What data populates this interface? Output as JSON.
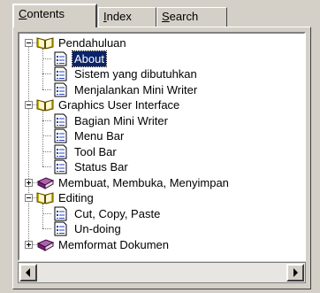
{
  "tabs": [
    {
      "label_ul": "C",
      "label_rest": "ontents",
      "active": true
    },
    {
      "label_ul": "I",
      "label_rest": "ndex",
      "active": false
    },
    {
      "label_ul": "S",
      "label_rest": "earch",
      "active": false
    }
  ],
  "tree": [
    {
      "level": 0,
      "type": "book-open",
      "expander": "minus",
      "label": "Pendahuluan"
    },
    {
      "level": 1,
      "type": "page",
      "label": "About",
      "selected": true
    },
    {
      "level": 1,
      "type": "page",
      "label": "Sistem yang dibutuhkan"
    },
    {
      "level": 1,
      "type": "page",
      "label": "Menjalankan Mini Writer"
    },
    {
      "level": 0,
      "type": "book-open",
      "expander": "minus",
      "label": "Graphics User Interface"
    },
    {
      "level": 1,
      "type": "page",
      "label": "Bagian Mini Writer"
    },
    {
      "level": 1,
      "type": "page",
      "label": "Menu Bar"
    },
    {
      "level": 1,
      "type": "page",
      "label": "Tool Bar"
    },
    {
      "level": 1,
      "type": "page",
      "label": "Status Bar"
    },
    {
      "level": 0,
      "type": "book-closed",
      "expander": "plus",
      "label": "Membuat, Membuka, Menyimpan"
    },
    {
      "level": 0,
      "type": "book-open",
      "expander": "minus",
      "label": "Editing"
    },
    {
      "level": 1,
      "type": "page",
      "label": "Cut, Copy, Paste"
    },
    {
      "level": 1,
      "type": "page",
      "label": "Un-doing"
    },
    {
      "level": 0,
      "type": "book-closed",
      "expander": "plus",
      "label": "Memformat Dokumen"
    }
  ],
  "colors": {
    "selection": "#0a246a",
    "book_open": "#c8b400",
    "book_closed": "#7a1f7a",
    "page": "#2040c0"
  },
  "icons": {
    "book_open": "open-book-icon",
    "book_closed": "closed-book-icon",
    "page": "help-page-icon",
    "scroll_left": "arrow-left-icon",
    "scroll_right": "arrow-right-icon"
  }
}
